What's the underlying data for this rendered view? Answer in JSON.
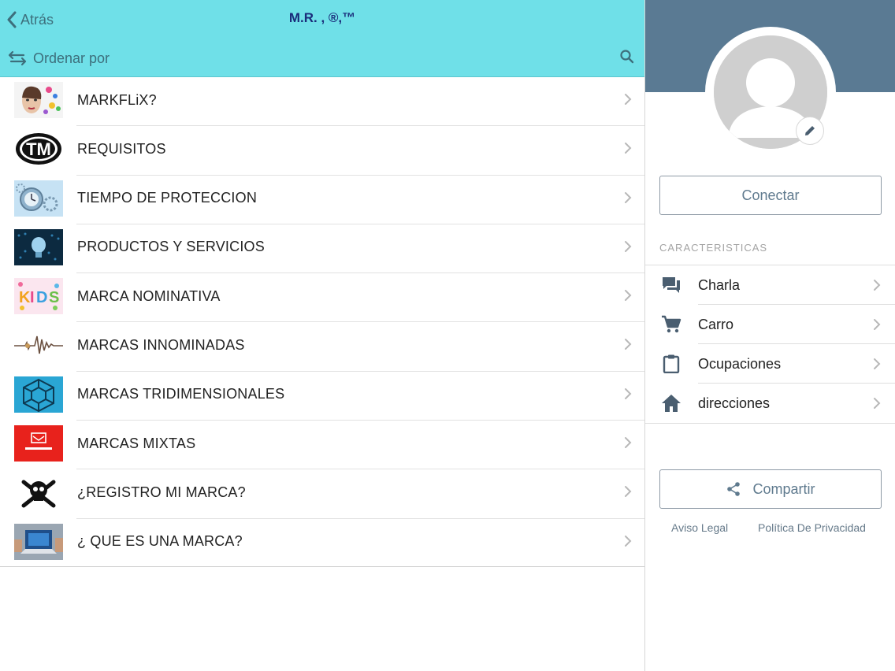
{
  "nav": {
    "back_label": "Atrás",
    "title": "M.R. , ®,™",
    "sort_label": "Ordenar por"
  },
  "items": [
    {
      "label": "MARKFLiX?",
      "thumb": "woman-colorful-thumb"
    },
    {
      "label": "REQUISITOS",
      "thumb": "tm-logo-thumb"
    },
    {
      "label": "TIEMPO DE PROTECCION",
      "thumb": "clock-gears-thumb"
    },
    {
      "label": "PRODUCTOS Y SERVICIOS",
      "thumb": "lightbulb-thumb"
    },
    {
      "label": "MARCA NOMINATIVA",
      "thumb": "kids-text-thumb"
    },
    {
      "label": "MARCAS INNOMINADAS",
      "thumb": "waveform-thumb"
    },
    {
      "label": "MARCAS TRIDIMENSIONALES",
      "thumb": "cube-thumb"
    },
    {
      "label": "MARCAS MIXTAS",
      "thumb": "red-logo-thumb"
    },
    {
      "label": "¿REGISTRO MI MARCA?",
      "thumb": "skull-thumb"
    },
    {
      "label": "¿ QUE ES UNA MARCA?",
      "thumb": "laptop-thumb"
    }
  ],
  "profile": {
    "connect_label": "Conectar",
    "features_heading": "CARACTERISTICAS",
    "features": [
      {
        "label": "Charla",
        "icon": "chat-icon"
      },
      {
        "label": "Carro",
        "icon": "cart-icon"
      },
      {
        "label": "Ocupaciones",
        "icon": "clipboard-icon"
      },
      {
        "label": "direcciones",
        "icon": "home-icon"
      }
    ],
    "share_label": "Compartir",
    "legal_notice": "Aviso Legal",
    "privacy_policy": "Política De Privacidad"
  },
  "colors": {
    "topbar": "#6fe0e8",
    "title": "#1a2c7a",
    "cover": "#5a7a93",
    "icon": "#4a5e70"
  }
}
